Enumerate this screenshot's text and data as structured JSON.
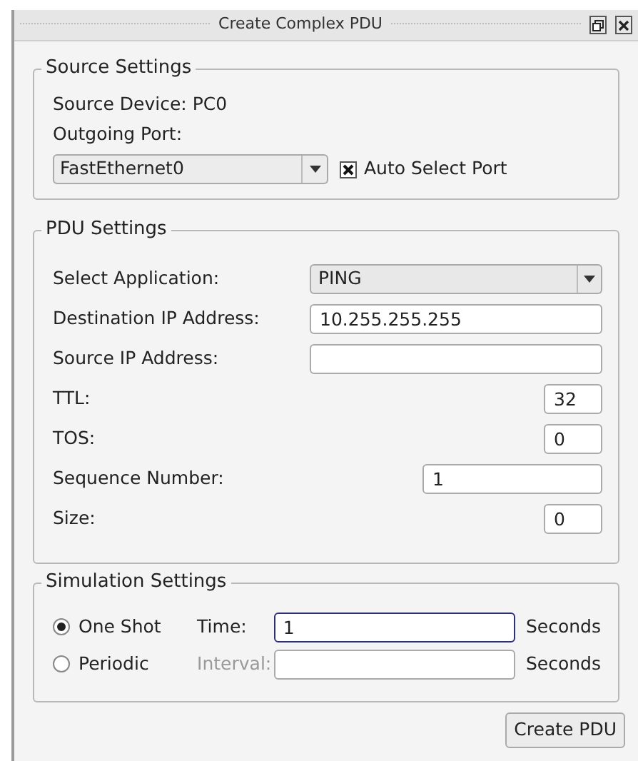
{
  "window": {
    "title": "Create Complex PDU"
  },
  "source_settings": {
    "title": "Source Settings",
    "source_device": "Source Device: PC0",
    "outgoing_port_label": "Outgoing Port:",
    "port_select": {
      "value": "FastEthernet0"
    },
    "auto_select": {
      "label": "Auto Select Port",
      "checked": true
    }
  },
  "pdu_settings": {
    "title": "PDU Settings",
    "rows": [
      {
        "kind": "select",
        "label": "Select Application:",
        "value": "PING"
      },
      {
        "kind": "wide",
        "label": "Destination IP Address:",
        "value": "10.255.255.255"
      },
      {
        "kind": "wide",
        "label": "Source IP Address:"
      },
      {
        "kind": "short",
        "label": "TTL:",
        "value": "32"
      },
      {
        "kind": "short",
        "label": "TOS:",
        "value": "0"
      },
      {
        "kind": "medium",
        "label": "Sequence Number:",
        "value": "1"
      },
      {
        "kind": "short",
        "label": "Size:",
        "value": "0"
      }
    ]
  },
  "simulation_settings": {
    "title": "Simulation Settings",
    "modes": [
      {
        "label": "One Shot",
        "selected": true,
        "field_label": "Time:",
        "value": "1",
        "focused": true,
        "unit": "Seconds"
      },
      {
        "label": "Periodic",
        "selected": false,
        "field_label": "Interval:",
        "focused": false,
        "unit": "Seconds"
      }
    ]
  },
  "create_button": {
    "label": "Create PDU"
  }
}
